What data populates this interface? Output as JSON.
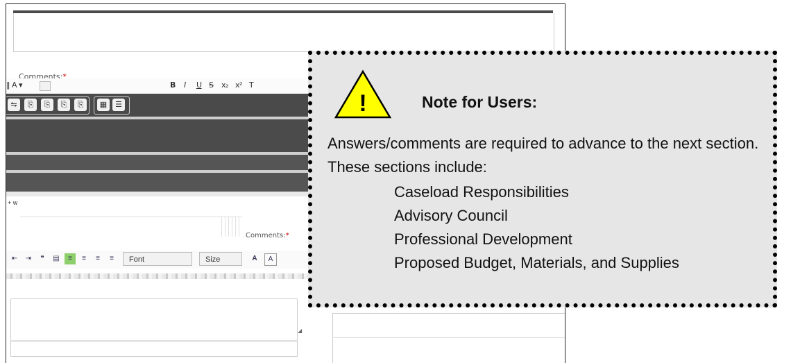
{
  "form": {
    "comments_label": "Comments:",
    "required_marker": "*",
    "comments_label_right": "Comments:",
    "toolbar_font": "Font",
    "toolbar_size": "Size"
  },
  "note": {
    "title": "Note for Users:",
    "warning_icon": "warning-triangle-icon",
    "warning_glyph": "!",
    "body": "Answers/comments are required to advance to the next section. These sections include:",
    "sections": [
      "Caseload Responsibilities",
      "Advisory Council",
      "Professional Development",
      "Proposed Budget, Materials, and Supplies"
    ]
  },
  "colors": {
    "callout_bg": "#e6e6e6",
    "warning_fill": "#ffff00",
    "toolbar_dark": "#4a4a4a",
    "required": "#cc0000"
  }
}
